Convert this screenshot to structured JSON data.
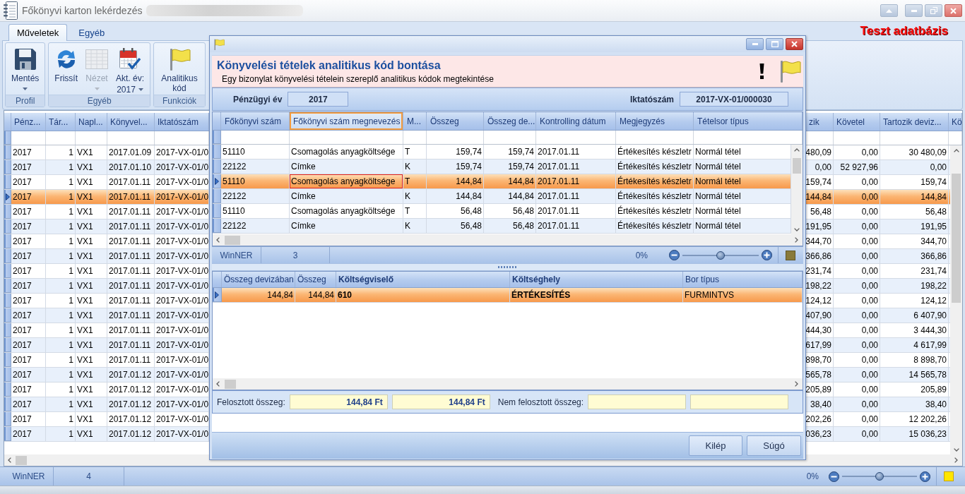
{
  "window": {
    "title": "Főkönyvi karton lekérdezés"
  },
  "ribbon": {
    "tabs": [
      {
        "label": "Műveletek",
        "selected": true
      },
      {
        "label": "Egyéb",
        "selected": false
      }
    ],
    "database_label": "Teszt adatbázis",
    "groups": [
      {
        "label": "Profil",
        "buttons": [
          {
            "kind": "save",
            "label": "Mentés",
            "dropdown": true,
            "disabled": false
          }
        ]
      },
      {
        "label": "Egyéb",
        "buttons": [
          {
            "kind": "refresh",
            "label": "Frissít",
            "dropdown": false,
            "disabled": false
          },
          {
            "kind": "view",
            "label": "Nézet",
            "dropdown": true,
            "disabled": true
          },
          {
            "kind": "calendar",
            "label": "Akt. év:",
            "value": "2017",
            "dropdown": true,
            "disabled": false
          }
        ]
      },
      {
        "label": "Funkciók",
        "buttons": [
          {
            "kind": "flag",
            "label": "Analitikus kód",
            "dropdown": false,
            "disabled": false
          }
        ]
      }
    ]
  },
  "main_grid": {
    "columns": [
      {
        "label": "Pénz...",
        "kind": "text"
      },
      {
        "label": "Tár...",
        "kind": "number"
      },
      {
        "label": "Napl...",
        "kind": "text"
      },
      {
        "label": "Könyvel...",
        "kind": "text"
      },
      {
        "label": "Iktatószám",
        "kind": "text"
      },
      {
        "label": "zik",
        "kind": "number"
      },
      {
        "label": "Követel",
        "kind": "number"
      },
      {
        "label": "Tartozik deviz...",
        "kind": "number"
      },
      {
        "label": "Kö",
        "kind": "number"
      }
    ],
    "rows": [
      {
        "cells": [
          "2017",
          "1",
          "VX1",
          "2017.01.09",
          "2017-VX-01/0",
          "480,09",
          "0,00",
          "30 480,09"
        ],
        "selected": false
      },
      {
        "cells": [
          "2017",
          "1",
          "VX1",
          "2017.01.10",
          "2017-VX-01/0",
          "0,00",
          "52 927,96",
          "0,00"
        ],
        "selected": false
      },
      {
        "cells": [
          "2017",
          "1",
          "VX1",
          "2017.01.11",
          "2017-VX-01/0",
          "159,74",
          "0,00",
          "159,74"
        ],
        "selected": false
      },
      {
        "cells": [
          "2017",
          "1",
          "VX1",
          "2017.01.11",
          "2017-VX-01/0",
          "144,84",
          "0,00",
          "144,84"
        ],
        "selected": true
      },
      {
        "cells": [
          "2017",
          "1",
          "VX1",
          "2017.01.11",
          "2017-VX-01/0",
          "56,48",
          "0,00",
          "56,48"
        ],
        "selected": false
      },
      {
        "cells": [
          "2017",
          "1",
          "VX1",
          "2017.01.11",
          "2017-VX-01/0",
          "191,95",
          "0,00",
          "191,95"
        ],
        "selected": false
      },
      {
        "cells": [
          "2017",
          "1",
          "VX1",
          "2017.01.11",
          "2017-VX-01/0",
          "344,70",
          "0,00",
          "344,70"
        ],
        "selected": false
      },
      {
        "cells": [
          "2017",
          "1",
          "VX1",
          "2017.01.11",
          "2017-VX-01/0",
          "366,86",
          "0,00",
          "366,86"
        ],
        "selected": false
      },
      {
        "cells": [
          "2017",
          "1",
          "VX1",
          "2017.01.11",
          "2017-VX-01/0",
          "231,74",
          "0,00",
          "231,74"
        ],
        "selected": false
      },
      {
        "cells": [
          "2017",
          "1",
          "VX1",
          "2017.01.11",
          "2017-VX-01/0",
          "198,22",
          "0,00",
          "198,22"
        ],
        "selected": false
      },
      {
        "cells": [
          "2017",
          "1",
          "VX1",
          "2017.01.11",
          "2017-VX-01/0",
          "124,12",
          "0,00",
          "124,12"
        ],
        "selected": false
      },
      {
        "cells": [
          "2017",
          "1",
          "VX1",
          "2017.01.11",
          "2017-VX-01/0",
          "407,90",
          "0,00",
          "6 407,90"
        ],
        "selected": false
      },
      {
        "cells": [
          "2017",
          "1",
          "VX1",
          "2017.01.11",
          "2017-VX-01/0",
          "444,30",
          "0,00",
          "3 444,30"
        ],
        "selected": false
      },
      {
        "cells": [
          "2017",
          "1",
          "VX1",
          "2017.01.11",
          "2017-VX-01/0",
          "617,99",
          "0,00",
          "4 617,99"
        ],
        "selected": false
      },
      {
        "cells": [
          "2017",
          "1",
          "VX1",
          "2017.01.11",
          "2017-VX-01/0",
          "898,70",
          "0,00",
          "8 898,70"
        ],
        "selected": false
      },
      {
        "cells": [
          "2017",
          "1",
          "VX1",
          "2017.01.12",
          "2017-VX-01/0",
          "565,78",
          "0,00",
          "14 565,78"
        ],
        "selected": false
      },
      {
        "cells": [
          "2017",
          "1",
          "VX1",
          "2017.01.12",
          "2017-VX-01/0",
          "205,89",
          "0,00",
          "205,89"
        ],
        "selected": false
      },
      {
        "cells": [
          "2017",
          "1",
          "VX1",
          "2017.01.12",
          "2017-VX-01/0",
          "38,40",
          "0,00",
          "38,40"
        ],
        "selected": false
      },
      {
        "cells": [
          "2017",
          "1",
          "VX1",
          "2017.01.12",
          "2017-VX-01/0",
          "202,26",
          "0,00",
          "12 202,26"
        ],
        "selected": false
      },
      {
        "cells": [
          "2017",
          "1",
          "VX1",
          "2017.01.12",
          "2017-VX-01/0",
          "036,23",
          "0,00",
          "15 036,23"
        ],
        "selected": false
      }
    ]
  },
  "status_bar": {
    "app": "WinNER",
    "count": "4",
    "zoom": {
      "label": "0%",
      "level": 0.5
    }
  },
  "dialog": {
    "header": {
      "title": "Könyvelési tételek analitikus kód bontása",
      "subtitle": "Egy bizonylat könyvelési tételein szereplő analitikus kódok megtekintése"
    },
    "fiscal_year": {
      "label": "Pénzügyi év",
      "value": "2017"
    },
    "document_number": {
      "label": "Iktatószám",
      "value": "2017-VX-01/000030"
    },
    "upper_grid": {
      "columns": [
        {
          "label": "Főkönyvi szám",
          "kind": "text",
          "focused": false
        },
        {
          "label": "Főkönyvi szám megnevezés",
          "kind": "text",
          "focused": true
        },
        {
          "label": "M...",
          "kind": "text",
          "focused": false
        },
        {
          "label": "Összeg",
          "kind": "number",
          "focused": false
        },
        {
          "label": "Összeg de...",
          "kind": "number",
          "focused": false
        },
        {
          "label": "Kontrolling dátum",
          "kind": "text",
          "focused": false
        },
        {
          "label": "Megjegyzés",
          "kind": "text",
          "focused": false
        },
        {
          "label": "Tételsor típus",
          "kind": "text",
          "focused": false
        }
      ],
      "rows": [
        {
          "cells": [
            "51110",
            "Csomagolás anyagköltsége",
            "T",
            "159,74",
            "159,74",
            "2017.01.11",
            "Értékesítés készletr",
            "Normál tétel"
          ],
          "selected": false
        },
        {
          "cells": [
            "22122",
            "Címke",
            "K",
            "159,74",
            "159,74",
            "2017.01.11",
            "Értékesítés készletr",
            "Normál tétel"
          ],
          "selected": false
        },
        {
          "cells": [
            "51110",
            "Csomagolás anyagköltsége",
            "T",
            "144,84",
            "144,84",
            "2017.01.11",
            "Értékesítés készletr",
            "Normál tétel"
          ],
          "selected": true
        },
        {
          "cells": [
            "22122",
            "Címke",
            "K",
            "144,84",
            "144,84",
            "2017.01.11",
            "Értékesítés készletr",
            "Normál tétel"
          ],
          "selected": false
        },
        {
          "cells": [
            "51110",
            "Csomagolás anyagköltsége",
            "T",
            "56,48",
            "56,48",
            "2017.01.11",
            "Értékesítés készletr",
            "Normál tétel"
          ],
          "selected": false
        },
        {
          "cells": [
            "22122",
            "Címke",
            "K",
            "56,48",
            "56,48",
            "2017.01.11",
            "Értékesítés készletr",
            "Normál tétel"
          ],
          "selected": false
        }
      ]
    },
    "upper_status_bar": {
      "app": "WinNER",
      "count": "3",
      "zoom": {
        "label": "0%",
        "level": 0.5
      }
    },
    "lower_grid": {
      "columns": [
        {
          "label": "Összeg devizában",
          "kind": "number"
        },
        {
          "label": "Összeg",
          "kind": "number"
        },
        {
          "label": "Költségviselő",
          "kind": "key"
        },
        {
          "label": "Költséghely",
          "kind": "key"
        },
        {
          "label": "Bor típus",
          "kind": "text"
        }
      ],
      "rows": [
        {
          "cells": [
            "144,84",
            "144,84",
            "610",
            "ÉRTÉKESÍTÉS",
            "FURMINTVS"
          ],
          "selected": true
        }
      ]
    },
    "totals": [
      {
        "label": "Felosztott összeg:",
        "values": [
          "144,84 Ft",
          "144,84 Ft"
        ]
      },
      {
        "label": "Nem felosztott összeg:"
      }
    ],
    "buttons": [
      "Kilép",
      "Súgó"
    ]
  }
}
